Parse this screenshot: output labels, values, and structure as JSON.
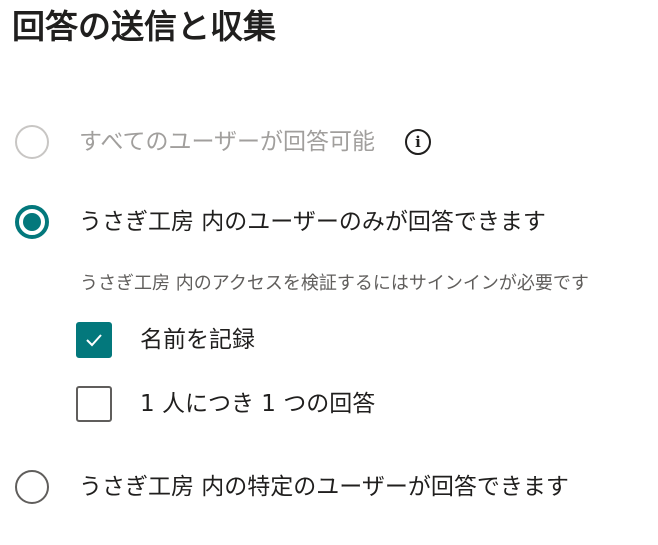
{
  "page": {
    "title": "回答の送信と収集"
  },
  "options": [
    {
      "label": "すべてのユーザーが回答可能",
      "state": "disabled",
      "info_icon": "info-icon"
    },
    {
      "label": "うさぎ工房 内のユーザーのみが回答できます",
      "state": "selected",
      "hint": "うさぎ工房 内のアクセスを検証するにはサインインが必要です",
      "checkboxes": [
        {
          "label": "名前を記録",
          "checked": true
        },
        {
          "label": "1 人につき 1 つの回答",
          "checked": false
        }
      ]
    },
    {
      "label": "うさぎ工房 内の特定のユーザーが回答できます",
      "state": "unselected"
    }
  ],
  "colors": {
    "accent": "#03787c",
    "text": "#201f1e",
    "disabled_text": "#a19f9d",
    "hint_text": "#605e5c"
  },
  "icons": {
    "info": "info-icon",
    "check": "checkmark-icon"
  }
}
